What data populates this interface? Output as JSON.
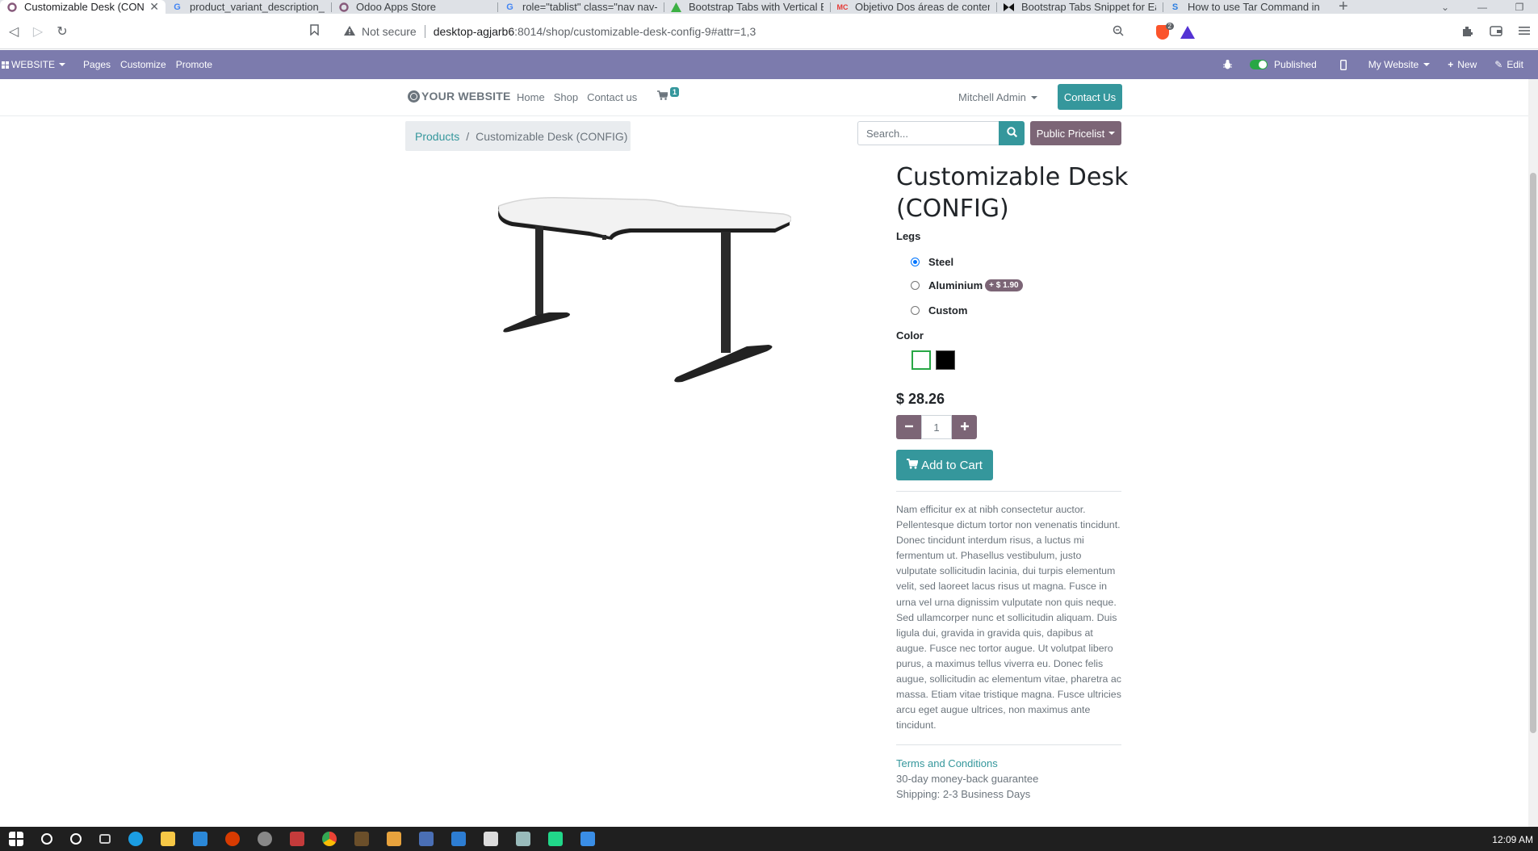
{
  "browser": {
    "tabs": [
      {
        "title": "Customizable Desk (CONFIG",
        "icon": "odoo-icon",
        "active": true
      },
      {
        "title": "product_variant_description_app",
        "icon": "google-icon"
      },
      {
        "title": "Odoo Apps Store",
        "icon": "odoo-icon"
      },
      {
        "title": "role=\"tablist\" class=\"nav nav-tab",
        "icon": "google-icon"
      },
      {
        "title": "Bootstrap Tabs with Vertical But",
        "icon": "triangle-icon"
      },
      {
        "title": "Objetivo Dos áreas de contenid",
        "icon": "mc-icon"
      },
      {
        "title": "Bootstrap Tabs Snippet for Easie",
        "icon": "bowtie-icon"
      },
      {
        "title": "How to use Tar Command in Lin",
        "icon": "s-icon"
      }
    ],
    "new_tab": "+",
    "address": {
      "security_label": "Not secure",
      "host": "desktop-agjarb6",
      "path": ":8014/shop/customizable-desk-config-9#attr=1,3"
    },
    "brave_badge": "2"
  },
  "adminbar": {
    "website_menu": "WEBSITE",
    "pages": "Pages",
    "customize": "Customize",
    "promote": "Promote",
    "published": "Published",
    "my_website": "My Website",
    "new": "New",
    "edit": "Edit"
  },
  "header": {
    "logo": "YOUR WEBSITE",
    "nav": [
      "Home",
      "Shop",
      "Contact us"
    ],
    "cart_count": "1",
    "user": "Mitchell Admin",
    "contact_button": "Contact Us"
  },
  "breadcrumb": {
    "parent": "Products",
    "separator": "/",
    "current": "Customizable Desk (CONFIG)"
  },
  "search": {
    "placeholder": "Search..."
  },
  "pricelist": "Public Pricelist",
  "product": {
    "title_line1": "Customizable Desk",
    "title_line2": "(CONFIG)",
    "legs_label": "Legs",
    "legs_options": [
      {
        "label": "Steel",
        "checked": true
      },
      {
        "label": "Aluminium",
        "extra": "+ $ 1.90"
      },
      {
        "label": "Custom"
      }
    ],
    "color_label": "Color",
    "colors": [
      "#ffffff",
      "#000000"
    ],
    "price": "$ 28.26",
    "quantity": "1",
    "add_to_cart": "Add to Cart",
    "description": "Nam efficitur ex at nibh consectetur auctor. Pellentesque dictum tortor non venenatis tincidunt. Donec tincidunt interdum risus, a luctus mi fermentum ut. Phasellus vestibulum, justo vulputate sollicitudin lacinia, dui turpis elementum velit, sed laoreet lacus risus ut magna. Fusce in urna vel urna dignissim vulputate non quis neque. Sed ullamcorper nunc et sollicitudin aliquam. Duis ligula dui, gravida in gravida quis, dapibus at augue. Fusce nec tortor augue. Ut volutpat libero purus, a maximus tellus viverra eu. Donec felis augue, sollicitudin ac elementum vitae, pharetra ac massa. Etiam vitae tristique magna. Fusce ultricies arcu eget augue ultrices, non maximus ante tincidunt.",
    "terms": "Terms and Conditions",
    "guarantee": "30-day money-back guarantee",
    "shipping": "Shipping: 2-3 Business Days"
  },
  "taskbar": {
    "clock": "12:09 AM"
  },
  "colors": {
    "admin_bar": "#7c7bad",
    "primary": "#35979c",
    "secondary": "#7c6576"
  }
}
